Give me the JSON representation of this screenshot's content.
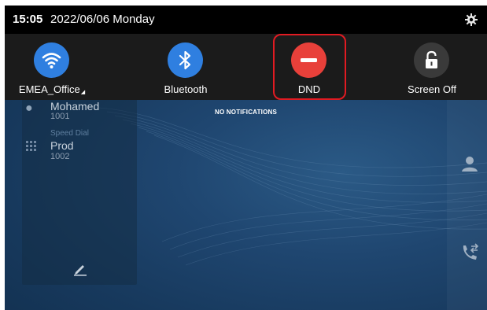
{
  "status_bar": {
    "time": "15:05",
    "date": "2022/06/06 Monday",
    "settings_icon": "gear-icon"
  },
  "quick_settings": {
    "tiles": [
      {
        "label": "EMEA_Office",
        "icon": "wifi-icon",
        "color": "#2f7fe0",
        "active": true
      },
      {
        "label": "Bluetooth",
        "icon": "bluetooth-icon",
        "color": "#2f7fe0",
        "active": true
      },
      {
        "label": "DND",
        "icon": "minus-icon",
        "color": "#e8403a",
        "active": true,
        "highlighted": true
      },
      {
        "label": "Screen Off",
        "icon": "lock-icon",
        "color": "#3a3a3a",
        "active": false
      }
    ]
  },
  "notifications": {
    "empty_text": "NO NOTIFICATIONS"
  },
  "home": {
    "contacts": [
      {
        "name": "Mohamed",
        "number": "1001",
        "icon": "person-icon"
      },
      {
        "label": "Speed Dial",
        "name": "Prod",
        "number": "1002",
        "icon": "dialpad-icon"
      }
    ],
    "edit_icon": "pencil-icon",
    "side_icons": [
      "contacts-icon",
      "call-transfer-icon"
    ]
  },
  "colors": {
    "accent_blue": "#2f7fe0",
    "dnd_red": "#e8403a",
    "highlight_outline": "#e11b22"
  }
}
